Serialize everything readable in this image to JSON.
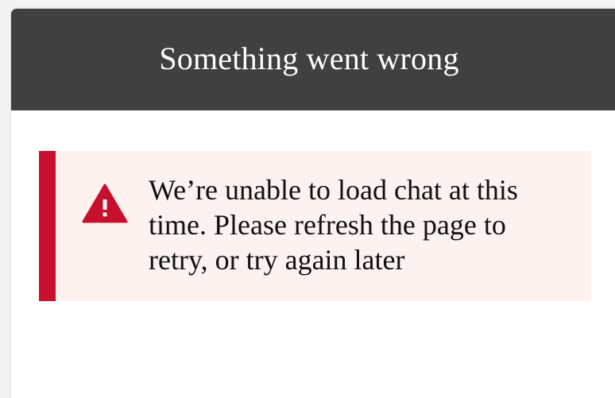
{
  "dialog": {
    "title": "Something went wrong"
  },
  "alert": {
    "icon": "warning-triangle-icon",
    "message": "We’re unable to load chat at this time. Please refresh the page to retry, or try again later"
  },
  "colors": {
    "header_bg": "#404040",
    "alert_accent": "#c8102e",
    "alert_bg": "#fcf2f0"
  }
}
